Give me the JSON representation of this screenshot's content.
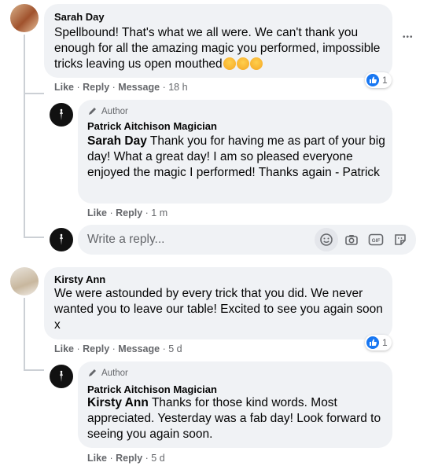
{
  "comments": [
    {
      "author": "Sarah Day",
      "text": "Spellbound! That's what we all were. We can't thank you enough for all the amazing magic you performed, impossible tricks leaving us open mouthed",
      "actions": {
        "like": "Like",
        "reply": "Reply",
        "message": "Message",
        "time": "18 h"
      },
      "reaction_count": "1",
      "reply": {
        "badge": "Author",
        "author": "Patrick Aitchison Magician",
        "mention": "Sarah Day",
        "text": " Thank you for having me as part of your big day! What a great day! I am so pleased everyone enjoyed the magic I performed! Thanks again - Patrick",
        "actions": {
          "like": "Like",
          "reply": "Reply",
          "time": "1 m"
        }
      }
    },
    {
      "author": "Kirsty Ann",
      "text": "We were astounded by every trick that you did. We never wanted you to leave our table! Excited to see you again soon x",
      "actions": {
        "like": "Like",
        "reply": "Reply",
        "message": "Message",
        "time": "5 d"
      },
      "reaction_count": "1",
      "reply": {
        "badge": "Author",
        "author": "Patrick Aitchison Magician",
        "mention": "Kirsty Ann",
        "text": " Thanks for those kind words. Most appreciated. Yesterday was a fab day! Look forward to seeing you again soon.",
        "actions": {
          "like": "Like",
          "reply": "Reply",
          "time": "5 d"
        }
      }
    }
  ],
  "reply_box": {
    "placeholder": "Write a reply..."
  },
  "more_options": "•••",
  "separator": " · ",
  "icons": [
    "more-options-icon",
    "emoji-icon",
    "camera-icon",
    "gif-icon",
    "sticker-icon",
    "like-icon",
    "pen-icon"
  ],
  "colors": {
    "accent": "#1877f2",
    "bubble": "#f0f2f5",
    "muted": "#65676b"
  }
}
